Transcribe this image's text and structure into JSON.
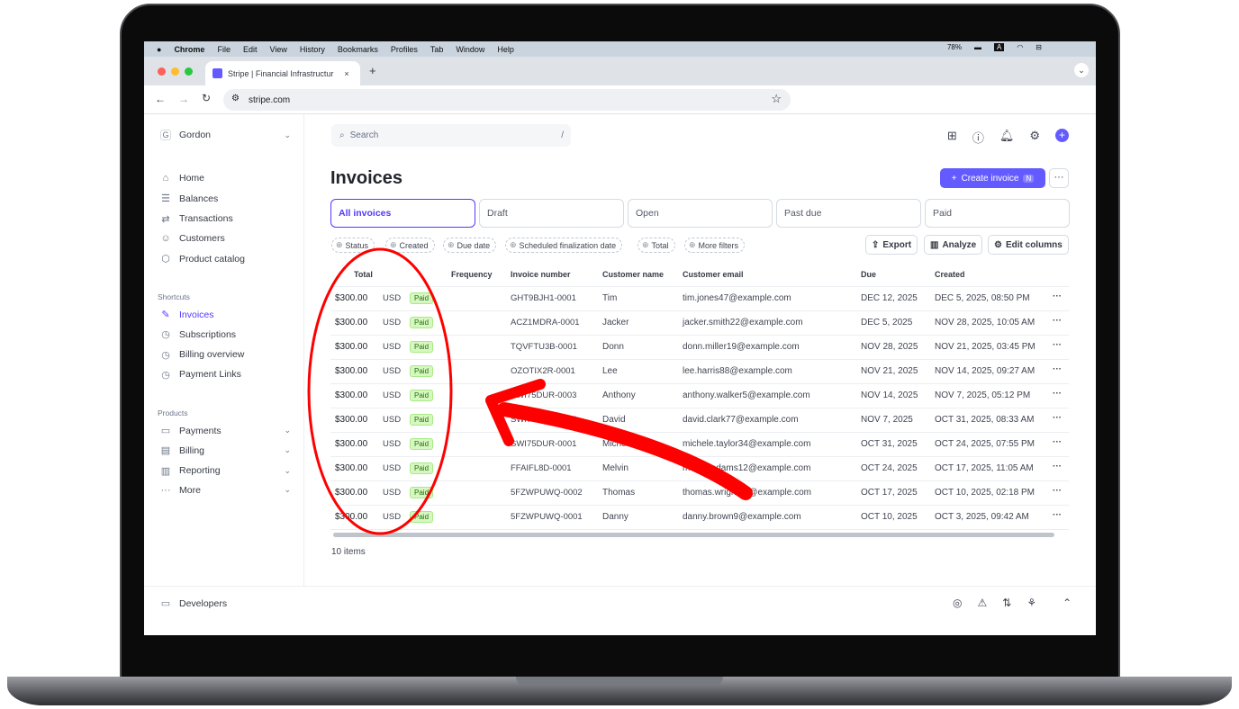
{
  "menubar": {
    "items": [
      "Chrome",
      "File",
      "Edit",
      "View",
      "History",
      "Bookmarks",
      "Profiles",
      "Tab",
      "Window",
      "Help"
    ],
    "battery": "78%",
    "input_source": "A"
  },
  "browser": {
    "tab_title": "Stripe | Financial Infrastructur",
    "tab_close": "×",
    "new_tab": "+",
    "url": "stripe.com"
  },
  "sidebar": {
    "account": "Gordon",
    "account_initial": "G",
    "items": [
      {
        "label": "Home",
        "icon": "⌂"
      },
      {
        "label": "Balances",
        "icon": "☰"
      },
      {
        "label": "Transactions",
        "icon": "⇄"
      },
      {
        "label": "Customers",
        "icon": "☺"
      },
      {
        "label": "Product catalog",
        "icon": "⬡"
      }
    ],
    "shortcuts_title": "Shortcuts",
    "shortcuts": [
      {
        "label": "Invoices",
        "icon": "✎",
        "active": true
      },
      {
        "label": "Subscriptions",
        "icon": "◷"
      },
      {
        "label": "Billing overview",
        "icon": "◷"
      },
      {
        "label": "Payment Links",
        "icon": "◷"
      }
    ],
    "products_title": "Products",
    "products": [
      {
        "label": "Payments",
        "icon": "▭"
      },
      {
        "label": "Billing",
        "icon": "▤"
      },
      {
        "label": "Reporting",
        "icon": "▥"
      },
      {
        "label": "More",
        "icon": "···"
      }
    ],
    "developers": "Developers"
  },
  "search": {
    "placeholder": "Search",
    "shortcut": "/"
  },
  "page": {
    "title": "Invoices",
    "create_label": "Create invoice",
    "create_shortcut": "N",
    "more": "···"
  },
  "tabs": [
    "All invoices",
    "Draft",
    "Open",
    "Past due",
    "Paid"
  ],
  "filters": [
    "Status",
    "Created",
    "Due date",
    "Scheduled finalization date",
    "Total",
    "More filters"
  ],
  "actions": {
    "export": "Export",
    "analyze": "Analyze",
    "edit_columns": "Edit columns"
  },
  "columns": [
    "Total",
    "Frequency",
    "Invoice number",
    "Customer name",
    "Customer email",
    "Due",
    "Created"
  ],
  "rows": [
    {
      "total": "$300.00",
      "currency": "USD",
      "status": "Paid",
      "number": "GHT9BJH1-0001",
      "name": "Tim",
      "email": "tim.jones47@example.com",
      "due": "DEC 12, 2025",
      "created": "DEC 5, 2025, 08:50 PM"
    },
    {
      "total": "$300.00",
      "currency": "USD",
      "status": "Paid",
      "number": "ACZ1MDRA-0001",
      "name": "Jacker",
      "email": "jacker.smith22@example.com",
      "due": "DEC 5, 2025",
      "created": "NOV 28, 2025, 10:05 AM"
    },
    {
      "total": "$300.00",
      "currency": "USD",
      "status": "Paid",
      "number": "TQVFTU3B-0001",
      "name": "Donn",
      "email": "donn.miller19@example.com",
      "due": "NOV 28, 2025",
      "created": "NOV 21, 2025, 03:45 PM"
    },
    {
      "total": "$300.00",
      "currency": "USD",
      "status": "Paid",
      "number": "OZOTIX2R-0001",
      "name": "Lee",
      "email": "lee.harris88@example.com",
      "due": "NOV 21, 2025",
      "created": "NOV 14, 2025, 09:27 AM"
    },
    {
      "total": "$300.00",
      "currency": "USD",
      "status": "Paid",
      "number": "SWI75DUR-0003",
      "name": "Anthony",
      "email": "anthony.walker5@example.com",
      "due": "NOV 14, 2025",
      "created": "NOV 7, 2025, 05:12 PM"
    },
    {
      "total": "$300.00",
      "currency": "USD",
      "status": "Paid",
      "number": "SWI75DUR-0002",
      "name": "David",
      "email": "david.clark77@example.com",
      "due": "NOV 7, 2025",
      "created": "OCT 31, 2025, 08:33 AM"
    },
    {
      "total": "$300.00",
      "currency": "USD",
      "status": "Paid",
      "number": "SWI75DUR-0001",
      "name": "Michele",
      "email": "michele.taylor34@example.com",
      "due": "OCT 31, 2025",
      "created": "OCT 24, 2025, 07:55 PM"
    },
    {
      "total": "$300.00",
      "currency": "USD",
      "status": "Paid",
      "number": "FFAIFL8D-0001",
      "name": "Melvin",
      "email": "melvin.adams12@example.com",
      "due": "OCT 24, 2025",
      "created": "OCT 17, 2025, 11:05 AM"
    },
    {
      "total": "$300.00",
      "currency": "USD",
      "status": "Paid",
      "number": "5FZWPUWQ-0002",
      "name": "Thomas",
      "email": "thomas.wright66@example.com",
      "due": "OCT 17, 2025",
      "created": "OCT 10, 2025, 02:18 PM"
    },
    {
      "total": "$300.00",
      "currency": "USD",
      "status": "Paid",
      "number": "5FZWPUWQ-0001",
      "name": "Danny",
      "email": "danny.brown9@example.com",
      "due": "OCT 10, 2025",
      "created": "OCT 3, 2025, 09:42 AM"
    }
  ],
  "item_count": "10 items",
  "annotation_color": "#ff0000"
}
